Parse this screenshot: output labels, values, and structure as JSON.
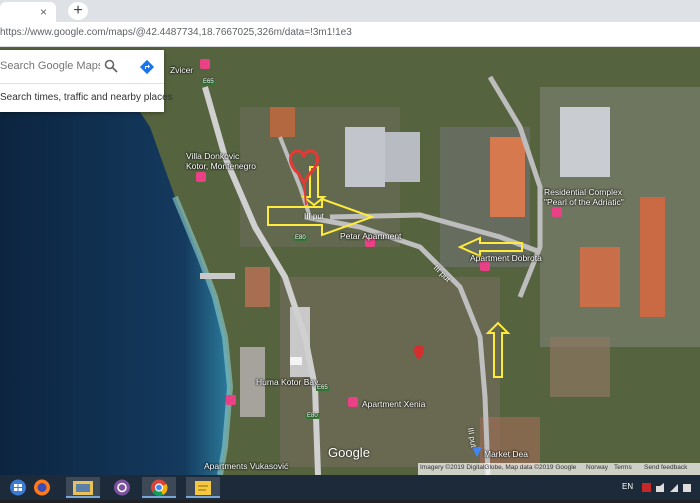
{
  "browser": {
    "tab_close": "×",
    "new_tab": "+",
    "url": "https://www.google.com/maps/@42.4487734,18.7667025,326m/data=!3m1!1e3"
  },
  "search": {
    "placeholder": "Search Google Maps",
    "suggestion": "Search times, traffic and nearby places"
  },
  "map": {
    "labels": {
      "zvicer": "Zvicer",
      "villa": "Villa Donkovic\nKotor, Montenegro",
      "petar": "Petar Apartment",
      "dobrota": "Apartment Dobrota",
      "residential": "Residential Complex\n\"Pearl of the Adriatic\"",
      "huma": "Huma Kotor Bay",
      "xenia": "Apartment Xenia",
      "market": "Market Dea",
      "vukasovic": "Apartments Vukasović"
    },
    "roads": {
      "road1": "III put",
      "road2": "III put",
      "road3": "III put",
      "e65a": "E65",
      "e65b": "E65",
      "e80": "E80",
      "e80b": "E80"
    },
    "google_logo": "Google",
    "footer": {
      "imagery": "Imagery ©2019 DigitalGlobe, Map data ©2019 Google",
      "country": "Norway",
      "terms": "Terms",
      "feedback": "Send feedback"
    }
  },
  "taskbar": {
    "language": "EN",
    "apps": [
      "firefox-icon",
      "file-manager-icon",
      "viber-icon",
      "chrome-icon",
      "notes-icon"
    ]
  },
  "colors": {
    "sea": "#0f2a4a",
    "road": "#d9d9d9",
    "arrow": "#ffeb3b",
    "pin": "#e94086",
    "heart": "#e53935"
  }
}
